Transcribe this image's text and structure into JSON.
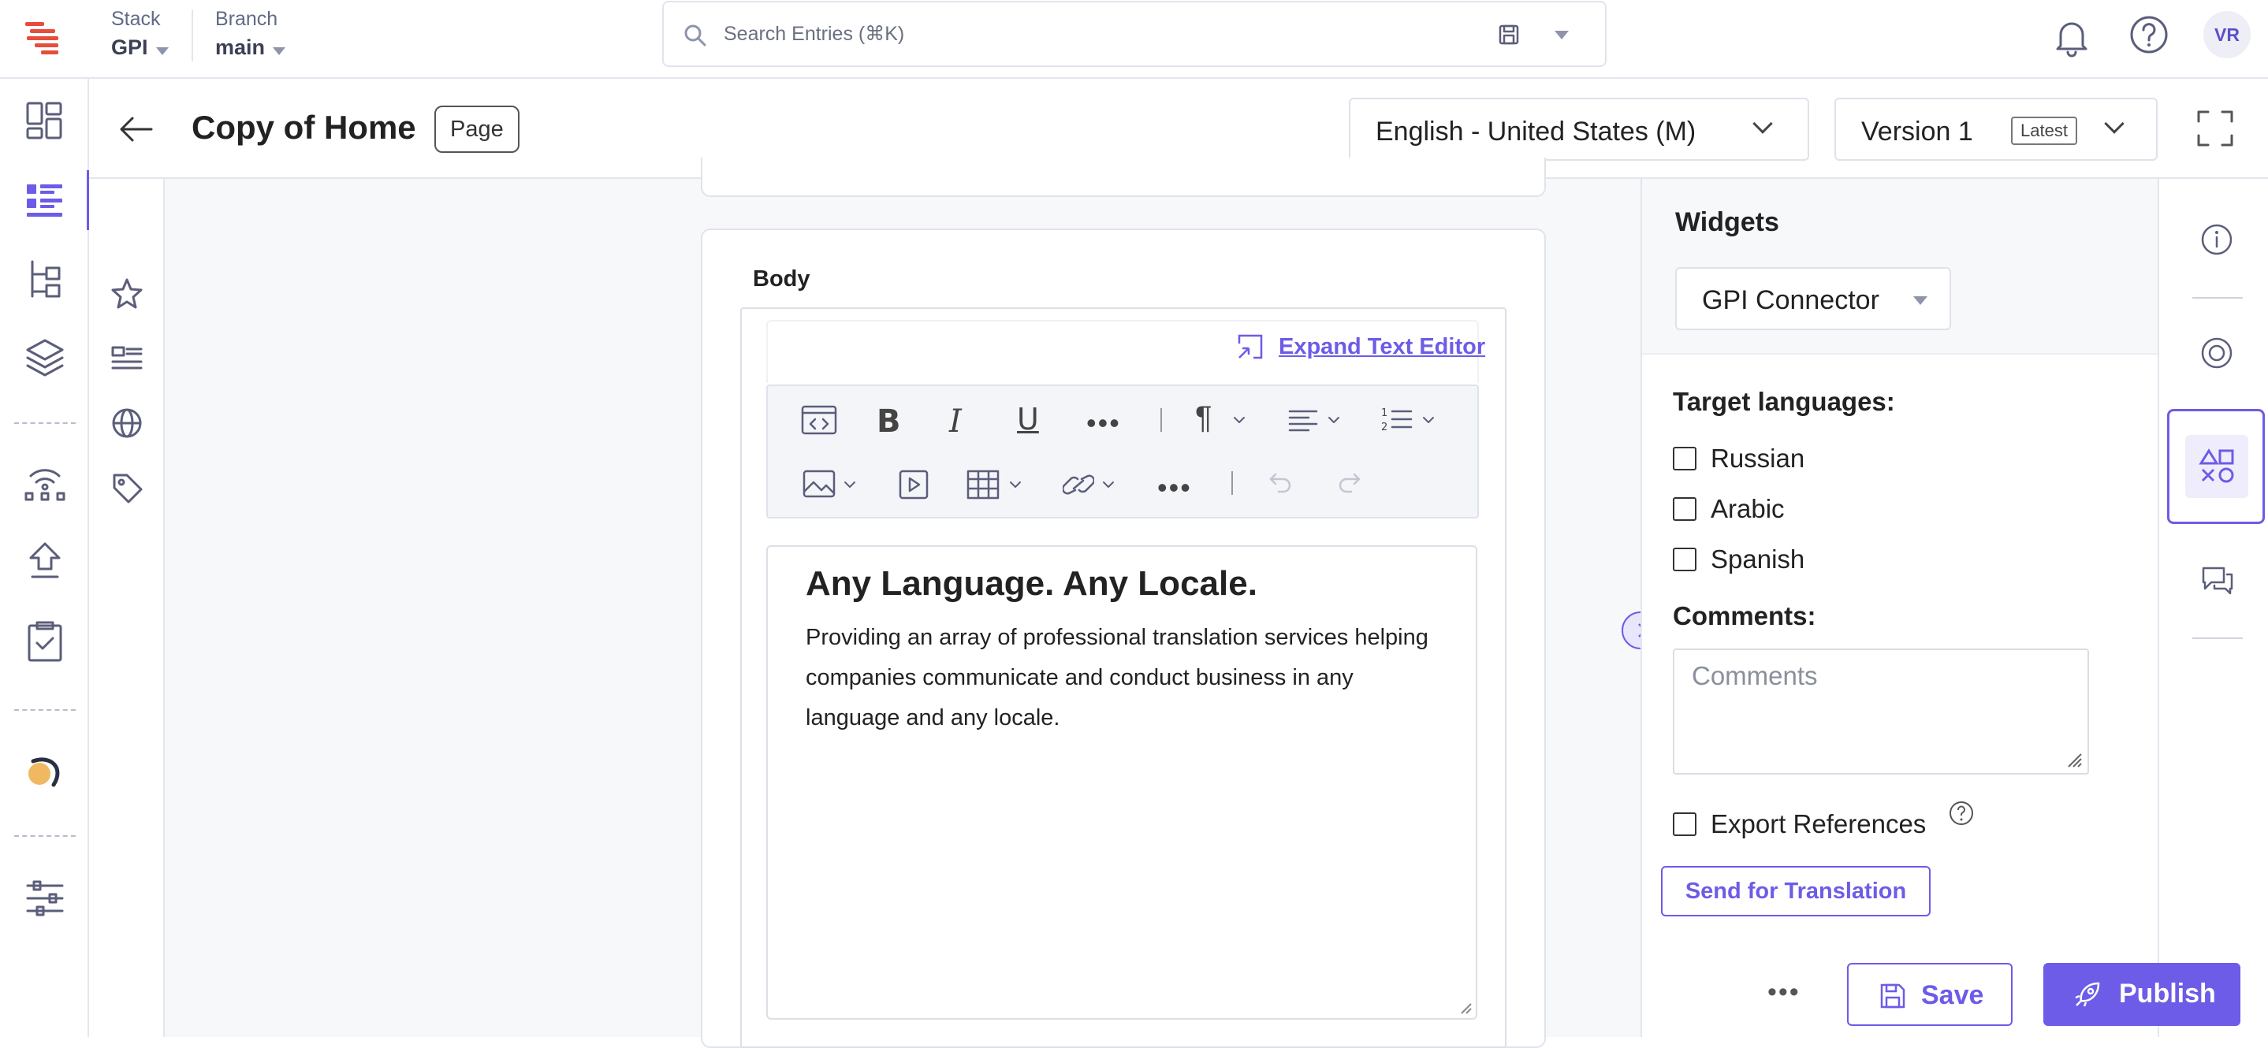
{
  "topbar": {
    "stack_label": "Stack",
    "stack_value": "GPI",
    "branch_label": "Branch",
    "branch_value": "main",
    "search_placeholder": "Search Entries (⌘K)",
    "avatar_initials": "VR"
  },
  "entry": {
    "title": "Copy of Home",
    "content_type": "Page",
    "locale": "English - United States (M)",
    "version": "Version 1",
    "version_badge": "Latest"
  },
  "body_field": {
    "label": "Body",
    "expand_link": "Expand Text Editor",
    "heading": "Any Language. Any Locale.",
    "paragraph": "Providing an array of professional translation services helping companies communicate and conduct business in any language and any locale."
  },
  "widgets": {
    "title": "Widgets",
    "selected_widget": "GPI Connector",
    "target_languages_label": "Target languages:",
    "languages": [
      "Russian",
      "Arabic",
      "Spanish"
    ],
    "comments_label": "Comments:",
    "comments_placeholder": "Comments",
    "export_references_label": "Export References",
    "send_button": "Send for Translation"
  },
  "actions": {
    "save": "Save",
    "publish": "Publish"
  },
  "colors": {
    "accent": "#6c5ce7",
    "brand_red": "#e74c3c",
    "icon_gray": "#5b5e7a"
  }
}
